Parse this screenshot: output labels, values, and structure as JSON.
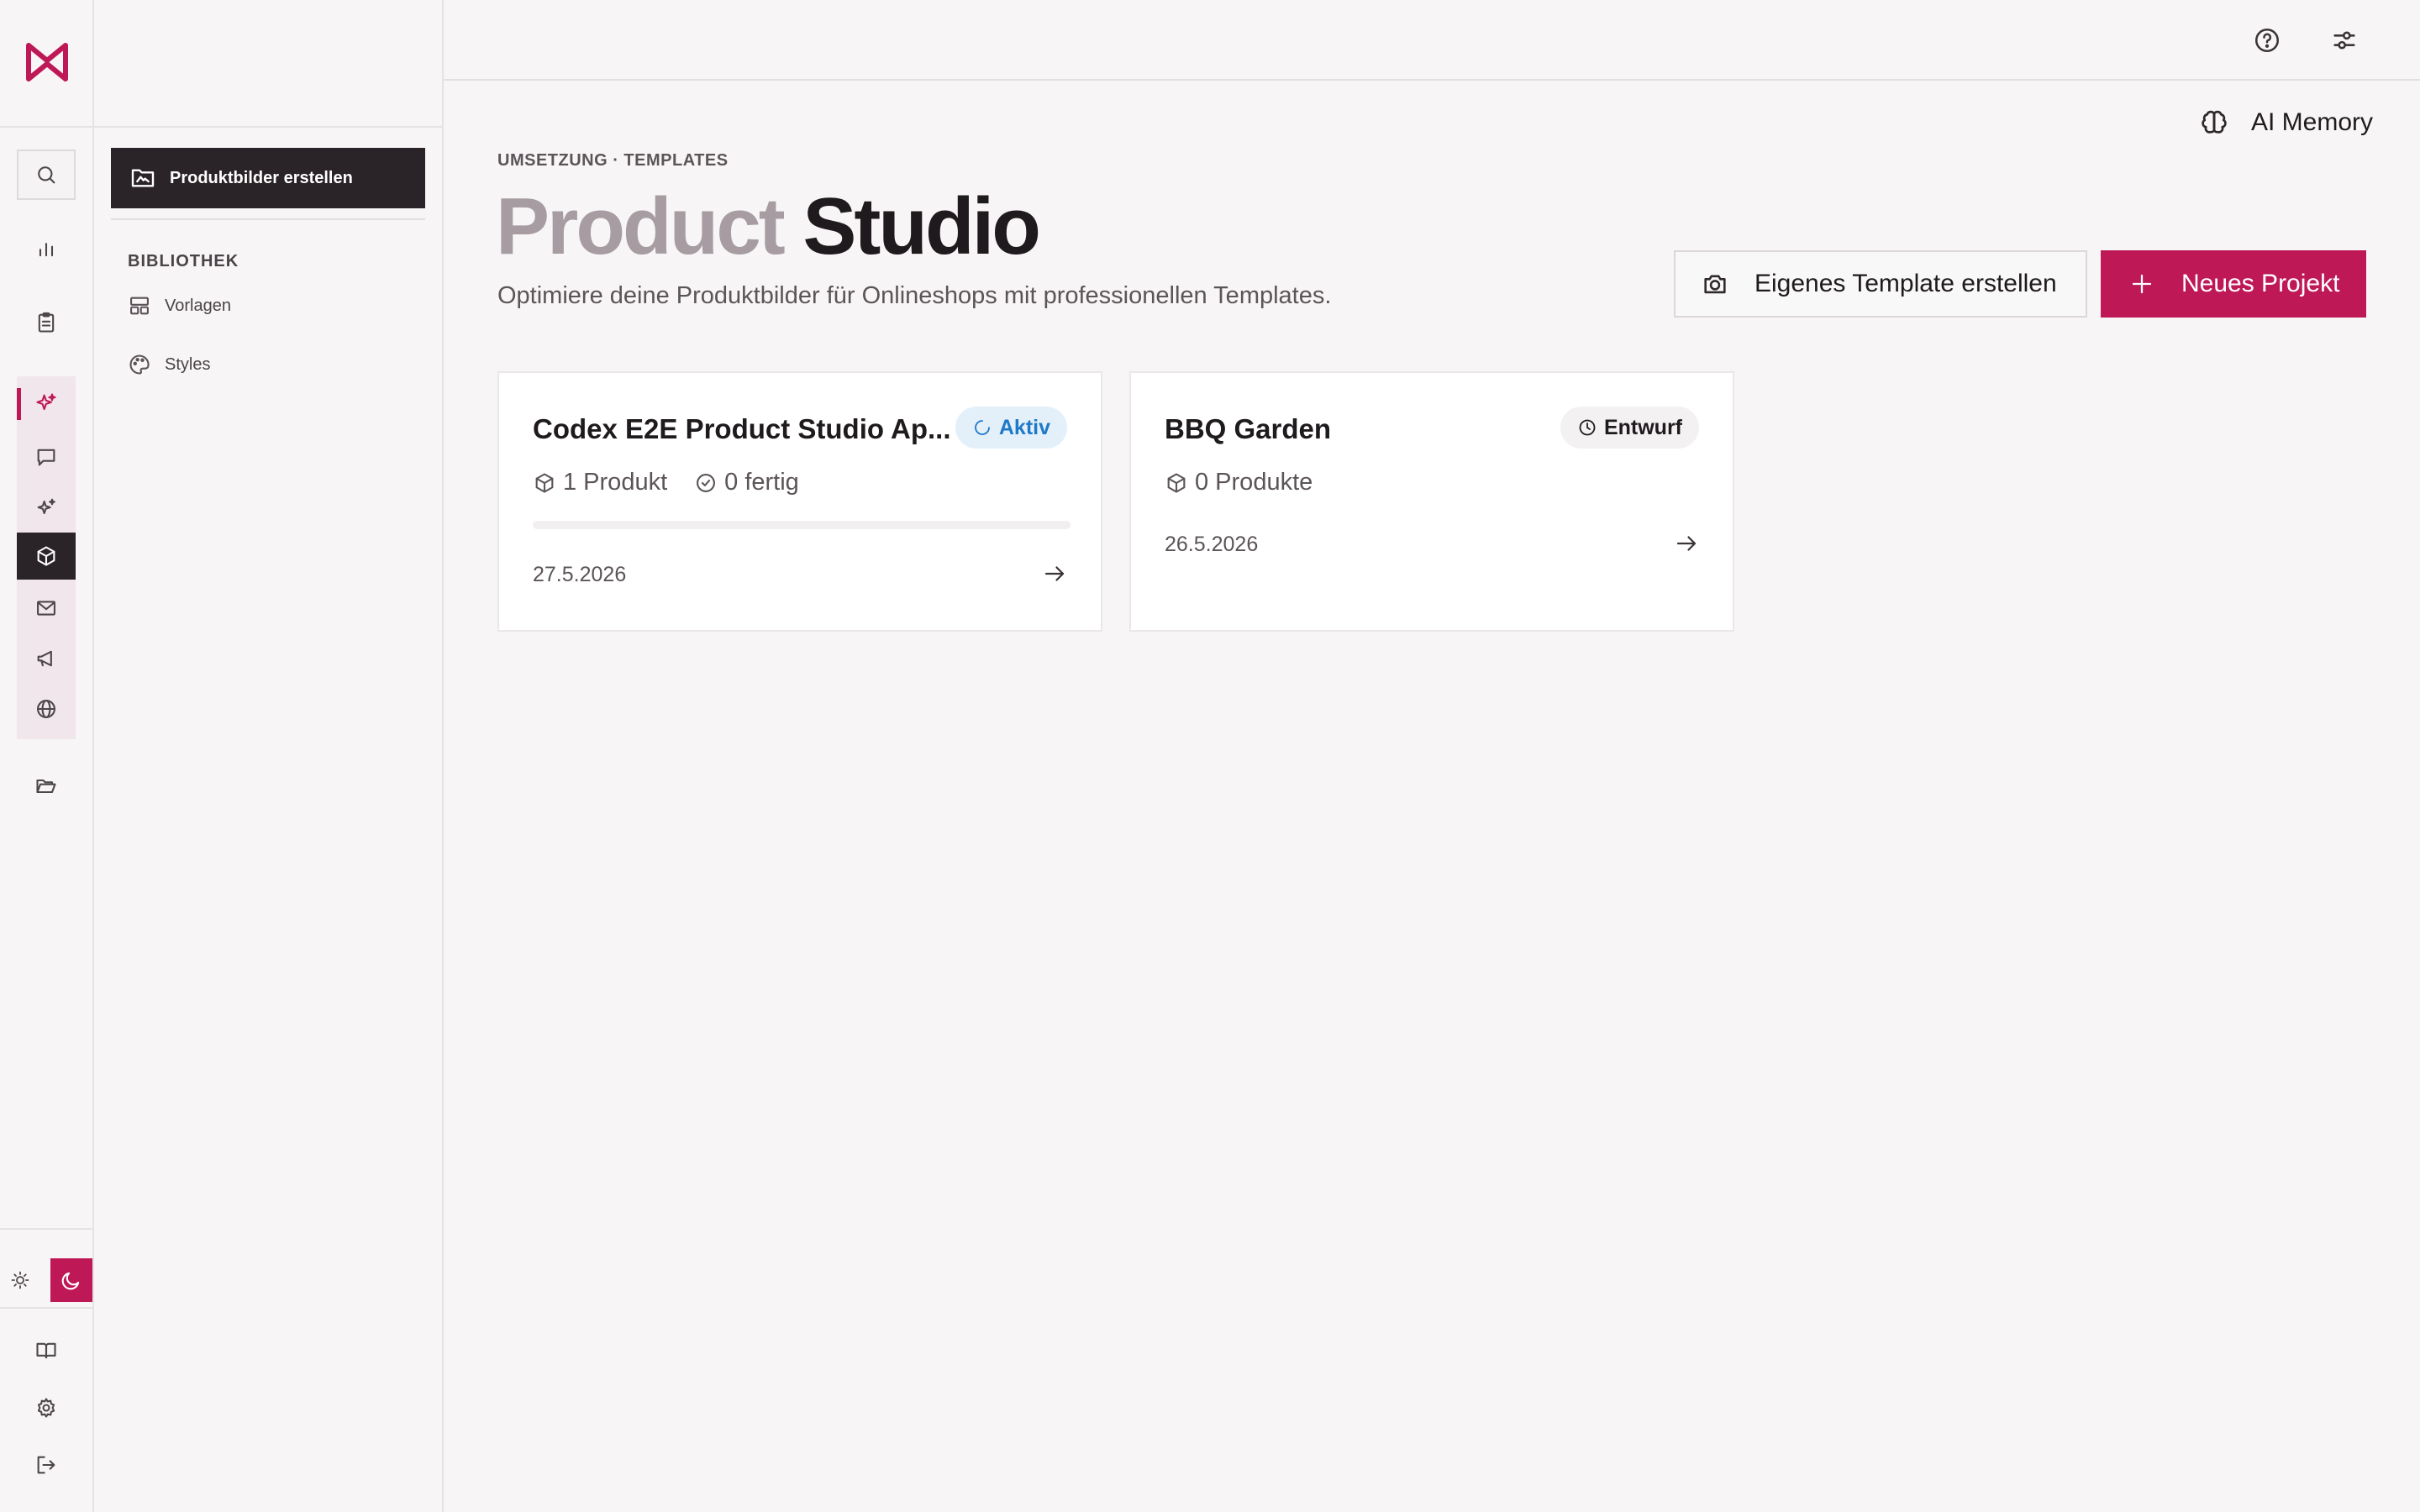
{
  "colors": {
    "accent": "#be1856",
    "dark": "#2a2327",
    "active_badge": "#1f78c8",
    "title_muted": "#a79ca2"
  },
  "rail": {
    "logo": "brand-logo",
    "icons": [
      "search-icon",
      "bar-chart-icon",
      "clipboard-icon",
      "sparkles-icon",
      "chat-icon",
      "sparkle-icon",
      "box-icon",
      "mail-icon",
      "megaphone-icon",
      "globe-icon",
      "folder-open-icon",
      "sun-icon",
      "moon-icon",
      "book-icon",
      "gear-icon",
      "logout-icon"
    ]
  },
  "sidebar": {
    "primary_label": "Produktbilder erstellen",
    "section_heading": "BIBLIOTHEK",
    "items": [
      {
        "label": "Vorlagen",
        "icon": "layout-icon"
      },
      {
        "label": "Styles",
        "icon": "palette-icon"
      }
    ]
  },
  "topbar": {
    "icons": [
      "help-icon",
      "settings-sliders-icon"
    ]
  },
  "main": {
    "ai_memory_label": "AI Memory",
    "breadcrumb": "UMSETZUNG · TEMPLATES",
    "title_part1": "Product",
    "title_part2": "Studio",
    "subtitle": "Optimiere deine Produktbilder für Onlineshops mit professionellen Templates.",
    "btn_template": "Eigenes Template erstellen",
    "btn_new": "Neues Projekt"
  },
  "projects": [
    {
      "title": "Codex E2E Product Studio Ap...",
      "status": "Aktiv",
      "products": "1 Produkt",
      "done": "0 fertig",
      "progress": 0,
      "date": "27.5.2026"
    },
    {
      "title": "BBQ Garden",
      "status": "Entwurf",
      "products": "0 Produkte",
      "date": "26.5.2026"
    }
  ]
}
